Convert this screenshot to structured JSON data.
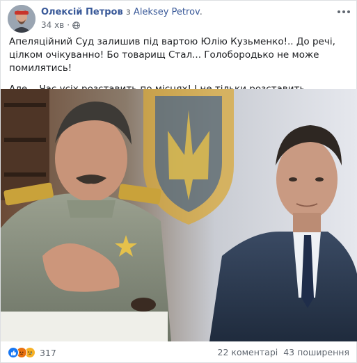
{
  "post": {
    "author_name": "Олексій Петров",
    "shared_from_prefix": "з",
    "shared_from_name": "Aleksey Petrov",
    "shared_from_suffix": ".",
    "time": "34 хв",
    "paragraph_1": "Апеляційний Суд залишив під вартою Юлію Кузьменко!.. До речі, цілком очікуванно! Бо товарищ Стал... Голобородько не може помилятись!",
    "paragraph_2": "Але... Час усіх розставить по місцях! І не тільки розставить..."
  },
  "footer": {
    "reaction_count": "317",
    "comments": "22 коментарі",
    "shares": "43 поширення"
  },
  "colors": {
    "link": "#385898",
    "meta": "#606770",
    "like": "#1877f2",
    "angry": "#e9710f",
    "sad": "#f7b125"
  },
  "icons": [
    "avatar",
    "globe-icon",
    "more-options-icon",
    "like-reaction-icon",
    "angry-reaction-icon",
    "sad-reaction-icon"
  ]
}
